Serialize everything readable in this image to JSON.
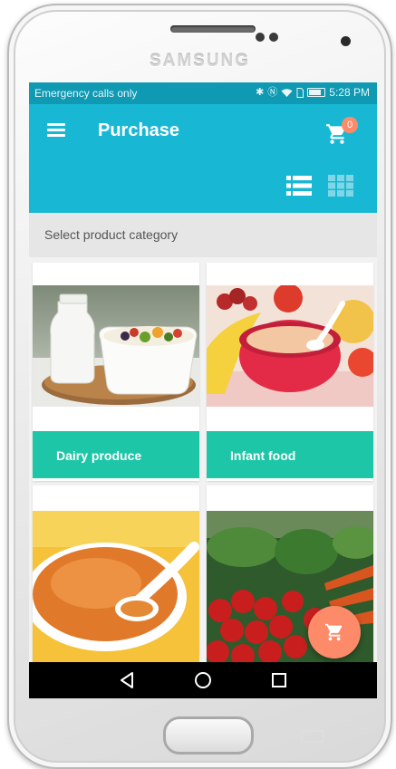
{
  "device": {
    "brand": "SAMSUNG"
  },
  "status_bar": {
    "carrier_text": "Emergency calls only",
    "time": "5:28 PM"
  },
  "app_bar": {
    "title": "Purchase",
    "cart_count": "0",
    "icons": {
      "menu": "hamburger-menu-icon",
      "cart": "shopping-cart-icon",
      "list_view": "list-view-icon",
      "grid_view": "grid-view-icon"
    }
  },
  "category_selector": {
    "placeholder": "Select product category"
  },
  "products": [
    {
      "label": "Dairy produce",
      "image": "milk bottle and fruit yogurt bowl"
    },
    {
      "label": "Infant food",
      "image": "baby porridge bowl with fruits"
    },
    {
      "label": "",
      "image": "orange puree bowl with spoon"
    },
    {
      "label": "",
      "image": "fresh vegetables and tomatoes"
    }
  ],
  "fab": {
    "icon": "shopping-cart-icon"
  },
  "nav_bar": {
    "icons": [
      "back-icon",
      "home-icon",
      "recent-apps-icon"
    ]
  },
  "colors": {
    "status_bar": "#0f99b2",
    "app_bar": "#18b8d4",
    "card_label": "#1ec6a8",
    "accent": "#fd8b69"
  }
}
